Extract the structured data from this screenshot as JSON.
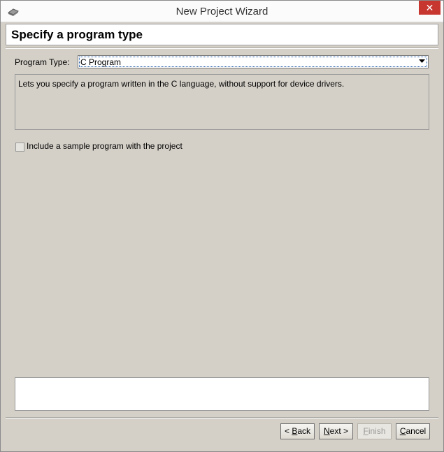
{
  "window": {
    "title": "New Project Wizard",
    "close_glyph": "✕",
    "app_icon": "wizard-app-icon"
  },
  "header": {
    "title": "Specify a program type"
  },
  "program_type": {
    "label": "Program Type:",
    "selected": "C Program",
    "description": "Lets you specify a program written in the C language, without support for device drivers."
  },
  "sample": {
    "label": "Include a sample program with the project",
    "checked": false
  },
  "message": "",
  "buttons": {
    "back_prefix": "< ",
    "back_accel": "B",
    "back_rest": "ack",
    "next_accel": "N",
    "next_rest": "ext >",
    "finish_accel": "F",
    "finish_rest": "inish",
    "cancel_accel": "C",
    "cancel_rest": "ancel"
  },
  "colors": {
    "close_button": "#c7372f",
    "dialog_bg": "#d4d0c8"
  }
}
